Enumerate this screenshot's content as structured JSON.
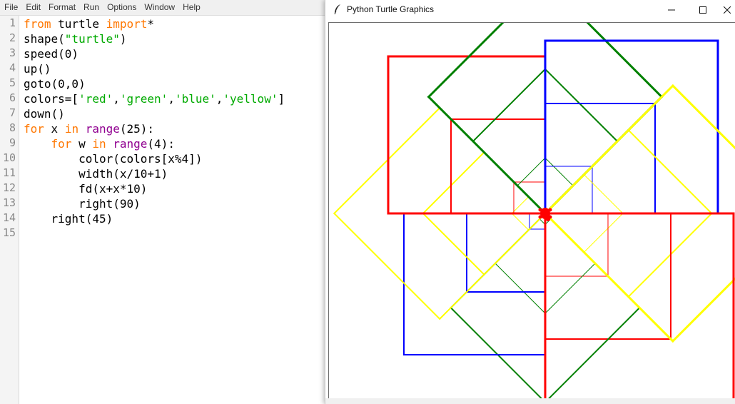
{
  "editor": {
    "menu": [
      "File",
      "Edit",
      "Format",
      "Run",
      "Options",
      "Window",
      "Help"
    ],
    "line_numbers": [
      "1",
      "2",
      "3",
      "4",
      "5",
      "6",
      "7",
      "8",
      "9",
      "10",
      "11",
      "12",
      "13",
      "14",
      "15"
    ],
    "code_lines": [
      [
        {
          "t": "from",
          "c": "kw"
        },
        {
          "t": " turtle ",
          "c": ""
        },
        {
          "t": "import",
          "c": "kw"
        },
        {
          "t": "*",
          "c": ""
        }
      ],
      [
        {
          "t": "shape(",
          "c": ""
        },
        {
          "t": "\"turtle\"",
          "c": "str"
        },
        {
          "t": ")",
          "c": ""
        }
      ],
      [
        {
          "t": "speed(0)",
          "c": ""
        }
      ],
      [
        {
          "t": "up()",
          "c": ""
        }
      ],
      [
        {
          "t": "goto(0,0)",
          "c": ""
        }
      ],
      [
        {
          "t": "colors=[",
          "c": ""
        },
        {
          "t": "'red'",
          "c": "str"
        },
        {
          "t": ",",
          "c": ""
        },
        {
          "t": "'green'",
          "c": "str"
        },
        {
          "t": ",",
          "c": ""
        },
        {
          "t": "'blue'",
          "c": "str"
        },
        {
          "t": ",",
          "c": ""
        },
        {
          "t": "'yellow'",
          "c": "str"
        },
        {
          "t": "]",
          "c": ""
        }
      ],
      [
        {
          "t": "down()",
          "c": ""
        }
      ],
      [
        {
          "t": "for",
          "c": "kw"
        },
        {
          "t": " x ",
          "c": ""
        },
        {
          "t": "in",
          "c": "kw"
        },
        {
          "t": " ",
          "c": ""
        },
        {
          "t": "range",
          "c": "bi"
        },
        {
          "t": "(25):",
          "c": ""
        }
      ],
      [
        {
          "t": "    ",
          "c": ""
        },
        {
          "t": "for",
          "c": "kw"
        },
        {
          "t": " w ",
          "c": ""
        },
        {
          "t": "in",
          "c": "kw"
        },
        {
          "t": " ",
          "c": ""
        },
        {
          "t": "range",
          "c": "bi"
        },
        {
          "t": "(4):",
          "c": ""
        }
      ],
      [
        {
          "t": "        color(colors[x%4])",
          "c": ""
        }
      ],
      [
        {
          "t": "        width(x/10+1)",
          "c": ""
        }
      ],
      [
        {
          "t": "        fd(x+x*10)",
          "c": ""
        }
      ],
      [
        {
          "t": "        right(90)",
          "c": ""
        }
      ],
      [
        {
          "t": "    right(45)",
          "c": ""
        }
      ],
      [
        {
          "t": "",
          "c": ""
        }
      ]
    ]
  },
  "turtle_window": {
    "title": "Python Turtle Graphics",
    "buttons": {
      "minimize": "minimize-icon",
      "maximize": "maximize-icon",
      "close": "close-icon"
    },
    "app_icon": "feather-icon",
    "colors": [
      "#ff0000",
      "#008000",
      "#0000ff",
      "#ffff00"
    ],
    "turtle_color": "#ff0000"
  }
}
